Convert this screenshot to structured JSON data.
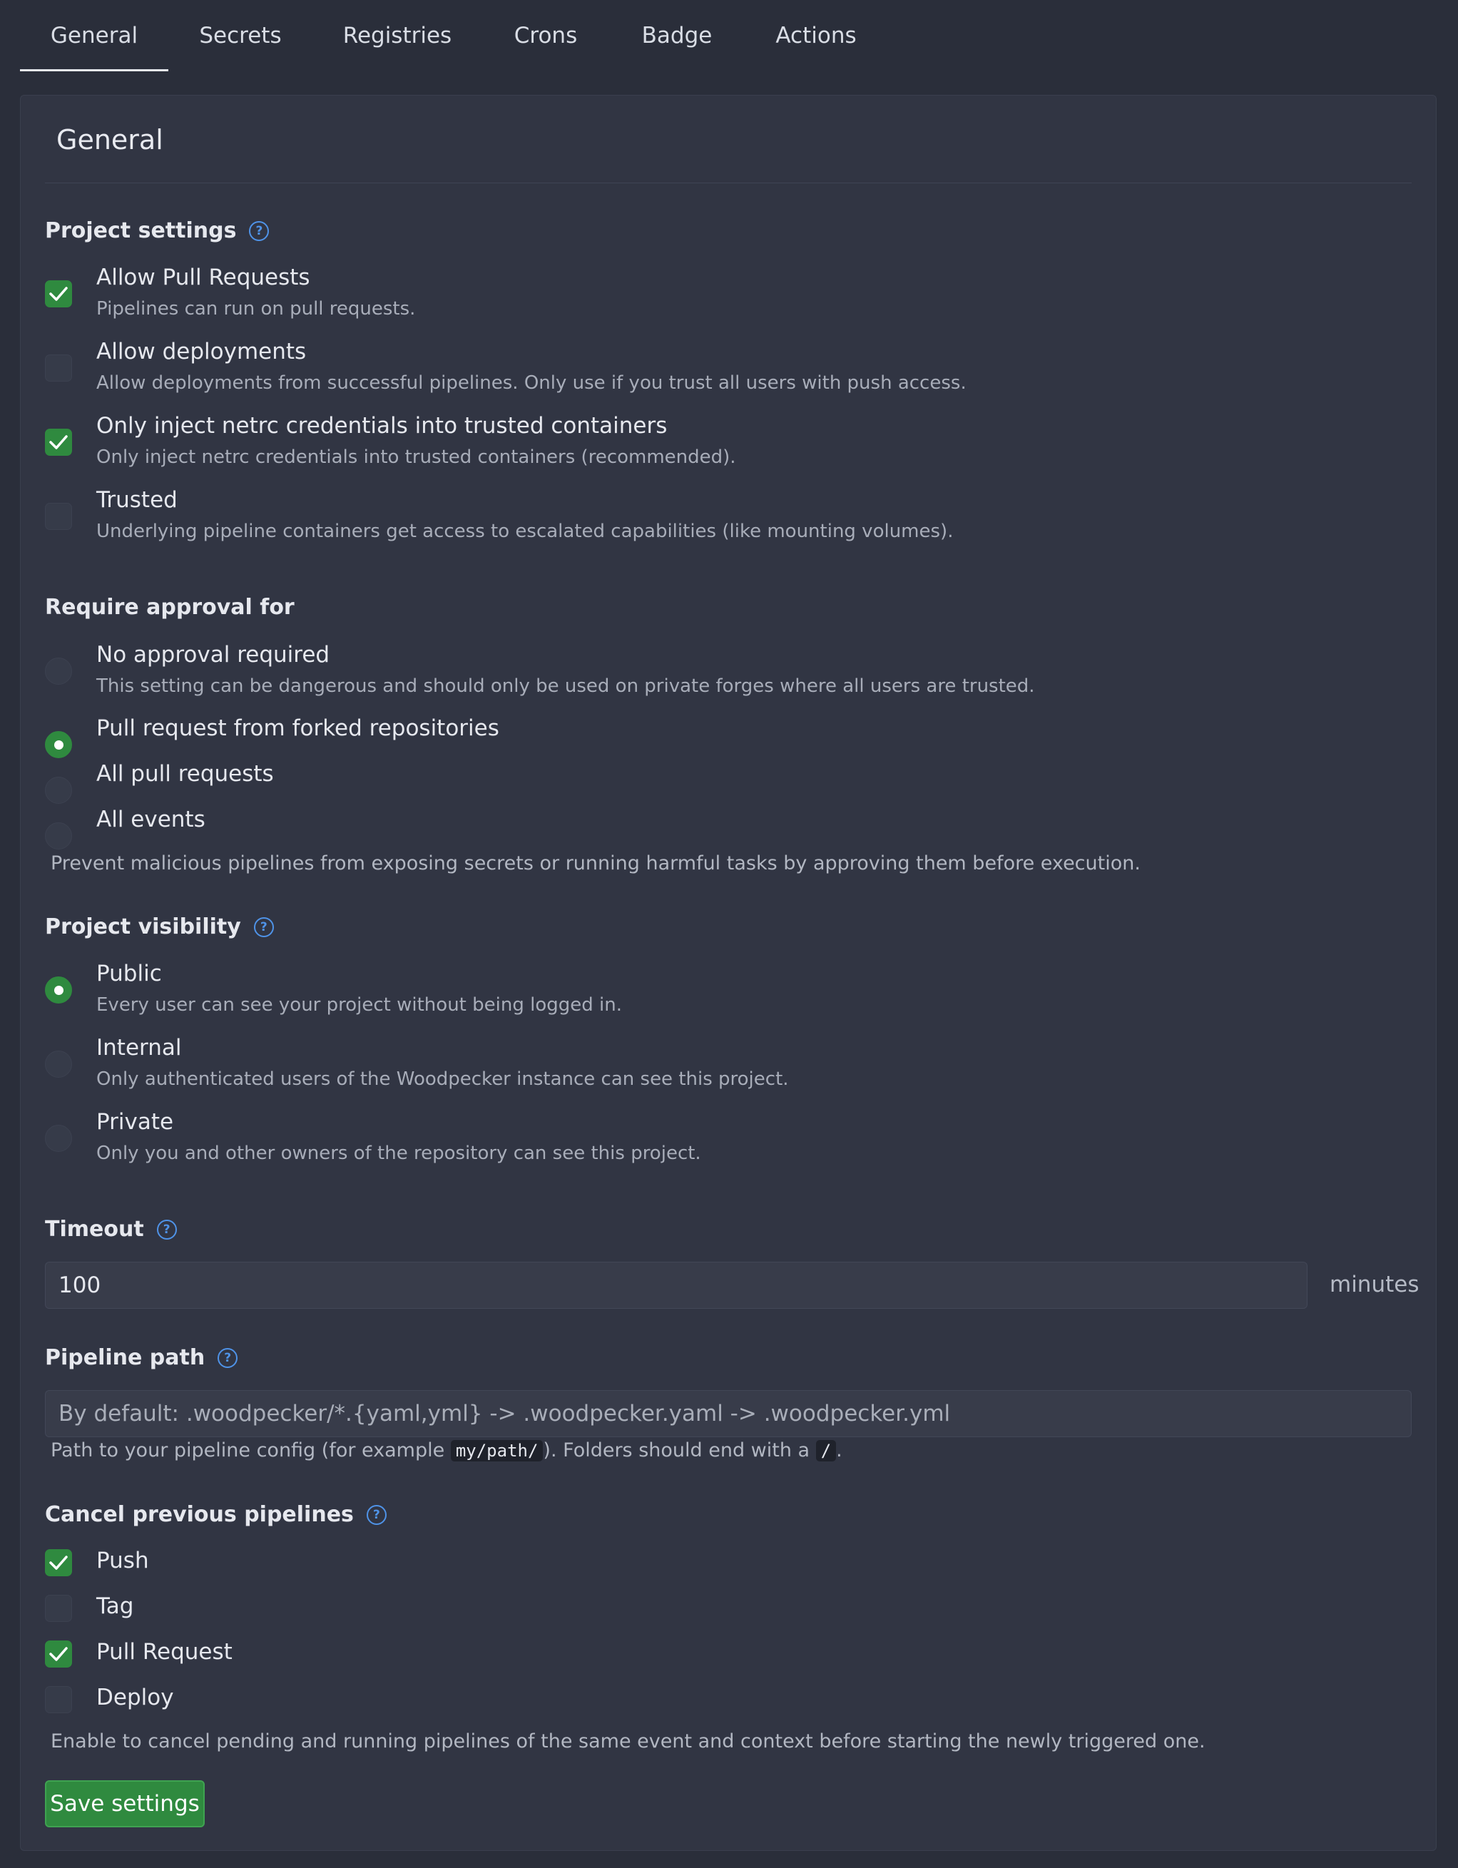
{
  "tabs": [
    "General",
    "Secrets",
    "Registries",
    "Crons",
    "Badge",
    "Actions"
  ],
  "active_tab": "General",
  "card_title": "General",
  "project_settings": {
    "heading": "Project settings",
    "options": [
      {
        "label": "Allow Pull Requests",
        "desc": "Pipelines can run on pull requests.",
        "checked": true
      },
      {
        "label": "Allow deployments",
        "desc": "Allow deployments from successful pipelines. Only use if you trust all users with push access.",
        "checked": false
      },
      {
        "label": "Only inject netrc credentials into trusted containers",
        "desc": "Only inject netrc credentials into trusted containers (recommended).",
        "checked": true
      },
      {
        "label": "Trusted",
        "desc": "Underlying pipeline containers get access to escalated capabilities (like mounting volumes).",
        "checked": false
      }
    ]
  },
  "approval": {
    "heading": "Require approval for",
    "options": [
      {
        "label": "No approval required",
        "desc": "This setting can be dangerous and should only be used on private forges where all users are trusted.",
        "selected": false
      },
      {
        "label": "Pull request from forked repositories",
        "selected": true
      },
      {
        "label": "All pull requests",
        "selected": false
      },
      {
        "label": "All events",
        "selected": false
      }
    ],
    "note": "Prevent malicious pipelines from exposing secrets or running harmful tasks by approving them before execution."
  },
  "visibility": {
    "heading": "Project visibility",
    "options": [
      {
        "label": "Public",
        "desc": "Every user can see your project without being logged in.",
        "selected": true
      },
      {
        "label": "Internal",
        "desc": "Only authenticated users of the Woodpecker instance can see this project.",
        "selected": false
      },
      {
        "label": "Private",
        "desc": "Only you and other owners of the repository can see this project.",
        "selected": false
      }
    ]
  },
  "timeout": {
    "heading": "Timeout",
    "value": "100",
    "unit": "minutes"
  },
  "pipeline_path": {
    "heading": "Pipeline path",
    "placeholder": "By default: .woodpecker/*.{yaml,yml} -> .woodpecker.yaml -> .woodpecker.yml",
    "note_before": "Path to your pipeline config (for example",
    "note_code1": "my/path/",
    "note_middle": "). Folders should end with a",
    "note_code2": "/",
    "note_after": "."
  },
  "cancel_previous": {
    "heading": "Cancel previous pipelines",
    "options": [
      {
        "label": "Push",
        "checked": true
      },
      {
        "label": "Tag",
        "checked": false
      },
      {
        "label": "Pull Request",
        "checked": true
      },
      {
        "label": "Deploy",
        "checked": false
      }
    ],
    "note": "Enable to cancel pending and running pipelines of the same event and context before starting the newly triggered one."
  },
  "save_label": "Save settings",
  "help_icon": "?",
  "colors": {
    "accent_green": "#2f8a3f",
    "help_blue": "#4f93e8",
    "background": "#2a2e3a",
    "card": "#313543"
  }
}
